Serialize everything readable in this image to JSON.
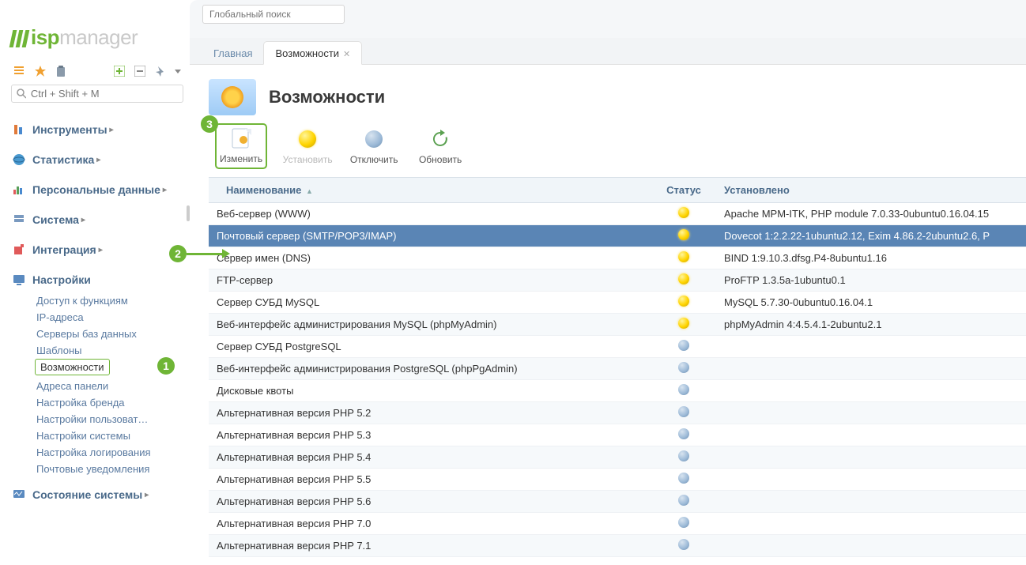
{
  "logo": {
    "isp": "isp",
    "manager": "manager"
  },
  "search": {
    "placeholder": "Ctrl + Shift + M"
  },
  "globalSearch": {
    "placeholder": "Глобальный поиск"
  },
  "menu": {
    "tools": "Инструменты",
    "stats": "Статистика",
    "personal": "Персональные данные",
    "system": "Система",
    "integration": "Интеграция",
    "settings": "Настройки",
    "settingsItems": {
      "access": "Доступ к функциям",
      "ip": "IP-адреса",
      "dbservers": "Серверы баз данных",
      "templates": "Шаблоны",
      "features": "Возможности",
      "panelAddr": "Адреса панели",
      "brand": "Настройка бренда",
      "users": "Настройки пользоват…",
      "sys": "Настройки системы",
      "logging": "Настройка логирования",
      "mailnotif": "Почтовые уведомления"
    },
    "state": "Состояние системы"
  },
  "badges": {
    "b1": "1",
    "b2": "2",
    "b3": "3"
  },
  "tabs": {
    "main": "Главная",
    "features": "Возможности"
  },
  "page": {
    "title": "Возможности"
  },
  "actions": {
    "edit": "Изменить",
    "install": "Установить",
    "disable": "Отключить",
    "update": "Обновить"
  },
  "columns": {
    "name": "Наименование",
    "status": "Статус",
    "installed": "Установлено"
  },
  "rows": [
    {
      "name": "Веб-сервер (WWW)",
      "on": true,
      "inst": "Apache MPM-ITK, PHP module 7.0.33-0ubuntu0.16.04.15",
      "sel": false,
      "alt": false
    },
    {
      "name": "Почтовый сервер (SMTP/POP3/IMAP)",
      "on": true,
      "inst": "Dovecot 1:2.2.22-1ubuntu2.12, Exim 4.86.2-2ubuntu2.6, P",
      "sel": true,
      "alt": true
    },
    {
      "name": "Сервер имен (DNS)",
      "on": true,
      "inst": "BIND 1:9.10.3.dfsg.P4-8ubuntu1.16",
      "sel": false,
      "alt": false
    },
    {
      "name": "FTP-сервер",
      "on": true,
      "inst": "ProFTP 1.3.5a-1ubuntu0.1",
      "sel": false,
      "alt": true
    },
    {
      "name": "Сервер СУБД MySQL",
      "on": true,
      "inst": "MySQL 5.7.30-0ubuntu0.16.04.1",
      "sel": false,
      "alt": false
    },
    {
      "name": "Веб-интерфейс администрирования MySQL (phpMyAdmin)",
      "on": true,
      "inst": "phpMyAdmin 4:4.5.4.1-2ubuntu2.1",
      "sel": false,
      "alt": true
    },
    {
      "name": "Сервер СУБД PostgreSQL",
      "on": false,
      "inst": "",
      "sel": false,
      "alt": false
    },
    {
      "name": "Веб-интерфейс администрирования PostgreSQL (phpPgAdmin)",
      "on": false,
      "inst": "",
      "sel": false,
      "alt": true
    },
    {
      "name": "Дисковые квоты",
      "on": false,
      "inst": "",
      "sel": false,
      "alt": false
    },
    {
      "name": "Альтернативная версия PHP 5.2",
      "on": false,
      "inst": "",
      "sel": false,
      "alt": true
    },
    {
      "name": "Альтернативная версия PHP 5.3",
      "on": false,
      "inst": "",
      "sel": false,
      "alt": false
    },
    {
      "name": "Альтернативная версия PHP 5.4",
      "on": false,
      "inst": "",
      "sel": false,
      "alt": true
    },
    {
      "name": "Альтернативная версия PHP 5.5",
      "on": false,
      "inst": "",
      "sel": false,
      "alt": false
    },
    {
      "name": "Альтернативная версия PHP 5.6",
      "on": false,
      "inst": "",
      "sel": false,
      "alt": true
    },
    {
      "name": "Альтернативная версия PHP 7.0",
      "on": false,
      "inst": "",
      "sel": false,
      "alt": false
    },
    {
      "name": "Альтернативная версия PHP 7.1",
      "on": false,
      "inst": "",
      "sel": false,
      "alt": true
    }
  ]
}
